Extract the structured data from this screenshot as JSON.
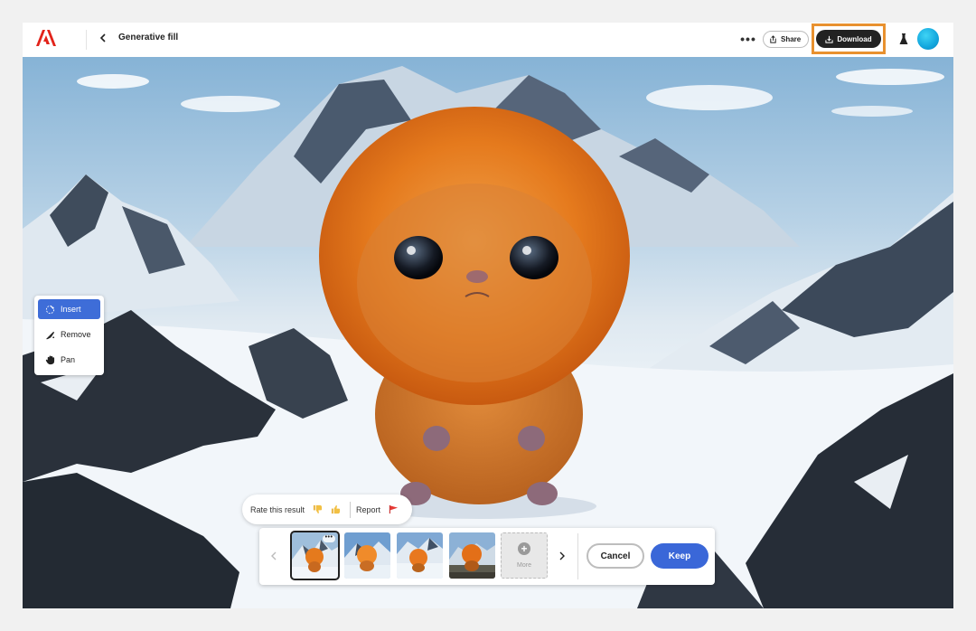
{
  "header": {
    "title": "Generative fill",
    "more_label": "•••",
    "share_label": "Share",
    "download_label": "Download"
  },
  "tools": [
    {
      "label": "Insert",
      "icon": "insert-brush-icon",
      "active": true
    },
    {
      "label": "Remove",
      "icon": "remove-brush-icon",
      "active": false
    },
    {
      "label": "Pan",
      "icon": "hand-icon",
      "active": false
    }
  ],
  "rating": {
    "prompt": "Rate this result",
    "report_label": "Report"
  },
  "variations": {
    "thumb_menu": "•••",
    "more_label": "More",
    "cancel_label": "Cancel",
    "keep_label": "Keep"
  },
  "colors": {
    "accent_blue": "#3a67d8",
    "highlight_orange": "#e8912f",
    "adobe_red": "#e2231a"
  }
}
